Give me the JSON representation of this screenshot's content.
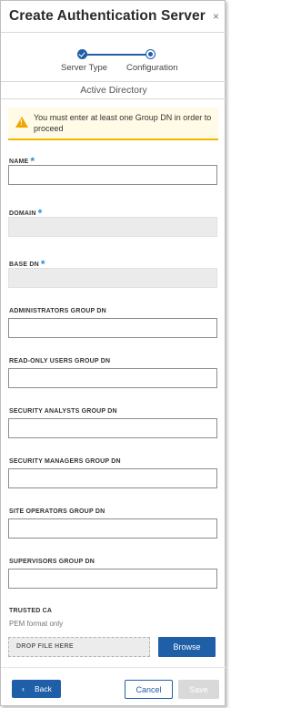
{
  "dialog": {
    "title": "Create Authentication Server",
    "close_glyph": "×"
  },
  "stepper": {
    "steps": [
      {
        "label": "Server Type",
        "state": "complete"
      },
      {
        "label": "Configuration",
        "state": "current"
      }
    ]
  },
  "section": {
    "title": "Active Directory"
  },
  "warning": {
    "icon": "warning-icon",
    "text": "You must enter at least one Group DN in order to proceed",
    "accent_color": "#f2b600"
  },
  "fields": [
    {
      "label": "NAME",
      "required": true,
      "required_mark": "*",
      "value": "",
      "disabled": false
    },
    {
      "label": "DOMAIN",
      "required": true,
      "required_mark": "*",
      "value": "",
      "disabled": true
    },
    {
      "label": "BASE DN",
      "required": true,
      "required_mark": "*",
      "value": "",
      "disabled": true
    },
    {
      "label": "ADMINISTRATORS GROUP DN",
      "required": false,
      "value": "",
      "disabled": false
    },
    {
      "label": "READ-ONLY USERS GROUP DN",
      "required": false,
      "value": "",
      "disabled": false
    },
    {
      "label": "SECURITY ANALYSTS GROUP DN",
      "required": false,
      "value": "",
      "disabled": false
    },
    {
      "label": "SECURITY MANAGERS GROUP DN",
      "required": false,
      "value": "",
      "disabled": false
    },
    {
      "label": "SITE OPERATORS GROUP DN",
      "required": false,
      "value": "",
      "disabled": false
    },
    {
      "label": "SUPERVISORS GROUP DN",
      "required": false,
      "value": "",
      "disabled": false
    }
  ],
  "trusted_ca": {
    "label": "TRUSTED CA",
    "hint": "PEM format only",
    "drop_text": "DROP FILE HERE",
    "browse_label": "Browse"
  },
  "footer": {
    "back_label": "Back",
    "back_glyph": "‹",
    "cancel_label": "Cancel",
    "save_label": "Save",
    "save_enabled": false
  },
  "colors": {
    "primary": "#1f5fa8",
    "required_asterisk": "#2a8fd4",
    "warning_bg": "#fffbe6",
    "disabled_input": "#ebebeb"
  }
}
